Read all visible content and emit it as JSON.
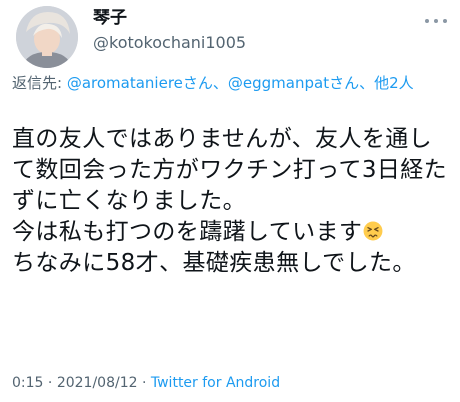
{
  "tweet": {
    "avatar_icon": "user-avatar-photo",
    "display_name": "琴子",
    "handle": "@kotokochani1005",
    "more_icon": "more-options-icon",
    "reply_to": {
      "prefix": "返信先: ",
      "mention_1": "@aromataniere",
      "san_1": "さん、",
      "mention_2": "@eggmanpat",
      "san_2": "さん、",
      "others": "他2人"
    },
    "text": "直の友人ではありませんが、友人を通して数回会った方がワクチン打って3日経たずに亡くなりました。\n今は私も打つのを躊躇しています",
    "text_emoji": "persevering-face-emoji",
    "text_after_emoji": "\nちなみに58才、基礎疾患無しでした。",
    "time": "0:15",
    "separator": " · ",
    "date": "2021/08/12",
    "source": "Twitter for Android"
  },
  "colors": {
    "link": "#1d9bf0",
    "secondary": "#536471",
    "text": "#0f1419"
  }
}
